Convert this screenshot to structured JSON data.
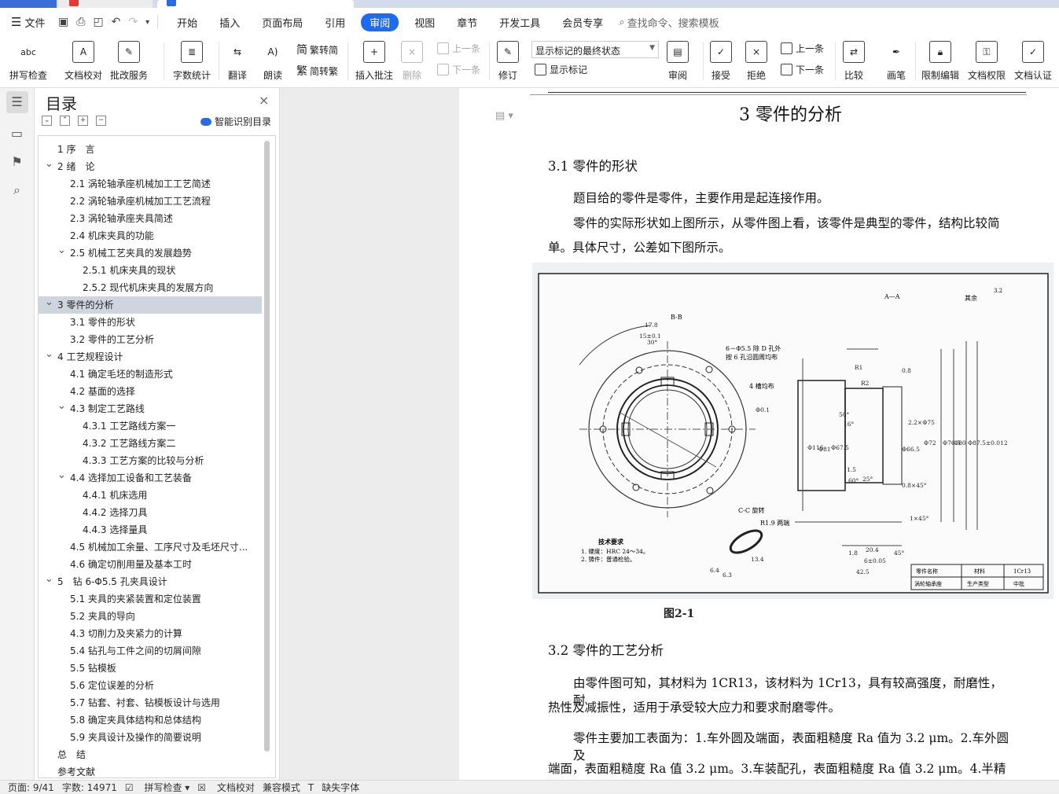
{
  "menubar": {
    "file_label": "文件",
    "items": [
      "开始",
      "插入",
      "页面布局",
      "引用",
      "审阅",
      "视图",
      "章节",
      "开发工具",
      "会员专享"
    ],
    "active_index": 4,
    "search_placeholder": "查找命令、搜索模板",
    "accent_color": "#1f6bf0"
  },
  "ribbon": {
    "spell_check": "拼写检查",
    "doc_proof": "文档校对",
    "comment_service": "批改服务",
    "word_count": "字数统计",
    "translate": "翻译",
    "read_aloud": "朗读",
    "trad_simp": "繁转简",
    "simp_trad": "简转繁",
    "insert_comment": "插入批注",
    "delete": "删除",
    "prev": "上一条",
    "next": "下一条",
    "track": "修订",
    "markup_view": "显示标记的最终状态",
    "show_markup": "显示标记",
    "review": "审阅",
    "accept": "接受",
    "reject": "拒绝",
    "prev2": "上一条",
    "next2": "下一条",
    "compare": "比较",
    "ink": "画笔",
    "restrict_edit": "限制编辑",
    "doc_rights": "文档权限",
    "doc_auth": "文档认证"
  },
  "toc": {
    "title": "目录",
    "ai_button": "智能识别目录",
    "items": [
      {
        "label": "1 序　言",
        "level": 1,
        "arrow": ""
      },
      {
        "label": "2 绪　论",
        "level": 1,
        "arrow": "v"
      },
      {
        "label": "2.1  涡轮轴承座机械加工工艺简述",
        "level": 2,
        "arrow": ""
      },
      {
        "label": "2.2 涡轮轴承座机械加工工艺流程",
        "level": 2,
        "arrow": ""
      },
      {
        "label": "2.3 涡轮轴承座夹具简述",
        "level": 2,
        "arrow": ""
      },
      {
        "label": "2.4 机床夹具的功能",
        "level": 2,
        "arrow": ""
      },
      {
        "label": "2.5 机械工艺夹具的发展趋势",
        "level": 2,
        "arrow": "v"
      },
      {
        "label": "2.5.1 机床夹具的现状",
        "level": 3,
        "arrow": ""
      },
      {
        "label": "2.5.2 现代机床夹具的发展方向",
        "level": 3,
        "arrow": ""
      },
      {
        "label": "3 零件的分析",
        "level": 1,
        "arrow": "v",
        "selected": true
      },
      {
        "label": "3.1 零件的形状",
        "level": 2,
        "arrow": ""
      },
      {
        "label": "3.2 零件的工艺分析",
        "level": 2,
        "arrow": ""
      },
      {
        "label": "4 工艺规程设计",
        "level": 1,
        "arrow": "v"
      },
      {
        "label": "4.1  确定毛坯的制造形式",
        "level": 2,
        "arrow": ""
      },
      {
        "label": "4.2  基面的选择",
        "level": 2,
        "arrow": ""
      },
      {
        "label": "4.3  制定工艺路线",
        "level": 2,
        "arrow": "v"
      },
      {
        "label": "4.3.1  工艺路线方案一",
        "level": 3,
        "arrow": ""
      },
      {
        "label": "4.3.2  工艺路线方案二",
        "level": 3,
        "arrow": ""
      },
      {
        "label": "4.3.3  工艺方案的比较与分析",
        "level": 3,
        "arrow": ""
      },
      {
        "label": "4.4  选择加工设备和工艺装备",
        "level": 2,
        "arrow": "v"
      },
      {
        "label": "4.4.1  机床选用",
        "level": 3,
        "arrow": ""
      },
      {
        "label": "4.4.2  选择刀具",
        "level": 3,
        "arrow": ""
      },
      {
        "label": "4.4.3  选择量具",
        "level": 3,
        "arrow": ""
      },
      {
        "label": "4.5  机械加工余量、工序尺寸及毛坯尺寸...",
        "level": 2,
        "arrow": ""
      },
      {
        "label": "4.6 确定切削用量及基本工时",
        "level": 2,
        "arrow": ""
      },
      {
        "label": "5　钻 6-Φ5.5 孔夹具设计",
        "level": 1,
        "arrow": "v"
      },
      {
        "label": "5.1  夹具的夹紧装置和定位装置",
        "level": 2,
        "arrow": ""
      },
      {
        "label": "5.2  夹具的导向",
        "level": 2,
        "arrow": ""
      },
      {
        "label": "4.3  切削力及夹紧力的计算",
        "level": 2,
        "arrow": ""
      },
      {
        "label": "5.4  钻孔与工件之间的切屑间隙",
        "level": 2,
        "arrow": ""
      },
      {
        "label": "5.5  钻模板",
        "level": 2,
        "arrow": ""
      },
      {
        "label": "5.6 定位误差的分析",
        "level": 2,
        "arrow": ""
      },
      {
        "label": "5.7  钻套、衬套、钻模板设计与选用",
        "level": 2,
        "arrow": ""
      },
      {
        "label": "5.8  确定夹具体结构和总体结构",
        "level": 2,
        "arrow": ""
      },
      {
        "label": "5.9  夹具设计及操作的简要说明",
        "level": 2,
        "arrow": ""
      },
      {
        "label": "总　结",
        "level": 1,
        "arrow": ""
      },
      {
        "label": "参考文献",
        "level": 1,
        "arrow": ""
      }
    ]
  },
  "doc": {
    "h1": "3  零件的分析",
    "h2_1": "3.1 零件的形状",
    "p1": "题目给的零件是零件，主要作用是起连接作用。",
    "p2a": "零件的实际形状如上图所示，从零件图上看，该零件是典型的零件，结构比较简",
    "p2b": "单。具体尺寸，公差如下图所示。",
    "fig_caption": "图2-1",
    "h2_2": "3.2 零件的工艺分析",
    "p3a": "由零件图可知，其材料为 1CR13，该材料为 1Cr13，具有较高强度，耐磨性，耐",
    "p3b": "热性及减振性，适用于承受较大应力和要求耐磨零件。",
    "p4a": "零件主要加工表面为：1.车外圆及端面，表面粗糙度 Ra 值为 3.2 μm。2.车外圆及",
    "p4b": "端面，表面粗糙度 Ra 值 3.2 μm。3.车装配孔，表面粗糙度 Ra 值 3.2 μm。4.半精车侧",
    "drawing": {
      "section_aa": "A—A",
      "rest": "其余",
      "rest_val": "3.2",
      "section_bb": "B-B",
      "holes_note1": "6－Φ5.5 除 D 孔外",
      "holes_note2": "按 6 孔沿圆周均布",
      "grooves": "4 槽均布",
      "cc": "C-C 旋转",
      "r19": "R1.9 两端",
      "tech_title": "技术要求",
      "tech1": "1. 硬度：HRC 24～34。",
      "tech2": "2. 铸件：普通检验。",
      "tb_part": "零件名称",
      "tb_mat": "材料",
      "tb_mat_val": "1Cr13",
      "tb_name": "涡轮轴承座",
      "tb_type": "生产类型",
      "tb_type_val": "中批",
      "dims": [
        "17.8",
        "15±0.1",
        "30°",
        "Φ0.1",
        "Φ116",
        "Φ81",
        "Φ67.5",
        "Φ66.5",
        "Φ72",
        "Φ76.5",
        "Φ80",
        "Φ87.5±0.012",
        "2.2×Φ75",
        "0.8×45°",
        "1×45°",
        "42.5",
        "20.4",
        "6±0.05",
        "45°",
        "R1",
        "R2",
        "0.8",
        "1.5",
        "25°",
        "60°",
        "50°",
        "1.8",
        "6.3",
        "13.4",
        "6.4",
        "16°"
      ]
    }
  },
  "status": {
    "page": "页面: 9/41",
    "words": "字数: 14971",
    "spell": "拼写检查",
    "proof": "文档校对",
    "compat": "兼容模式",
    "missing_font": "缺失字体"
  }
}
